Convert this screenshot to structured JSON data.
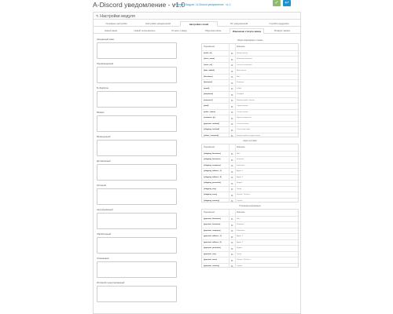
{
  "header": {
    "title": "A-Discord уведомление - v1.0",
    "breadcrumb": {
      "home": "Главная",
      "sep": "/",
      "modules": "Модули",
      "current": "A-Discord уведомление - v1.0"
    },
    "save_icon": "✓",
    "back_icon": "↩"
  },
  "panel": {
    "title": "Настройки модуля",
    "pencil_icon": "✎"
  },
  "tabs": [
    {
      "label": "Основные настройки",
      "active": false
    },
    {
      "label": "Настройка уведомлений",
      "active": false
    },
    {
      "label": "Настройка статей",
      "active": true
    },
    {
      "label": "Лог уведомлений",
      "active": false
    },
    {
      "label": "Служба поддержки",
      "active": false
    }
  ],
  "subtabs": [
    {
      "label": "Новый заказ",
      "active": false
    },
    {
      "label": "Новый пользователь",
      "active": false
    },
    {
      "label": "Отзыв к товару",
      "active": false
    },
    {
      "label": "Обратная связь",
      "active": false
    },
    {
      "label": "Изменение статуса заказа",
      "active": true
    },
    {
      "label": "Возврат заказа",
      "active": false
    }
  ],
  "fields": [
    {
      "label": "Ожидающий заказ"
    },
    {
      "label": "Подтвержденный"
    },
    {
      "label": "В обработке"
    },
    {
      "label": "Возврат"
    },
    {
      "label": "Возмещенный"
    },
    {
      "label": "Доставленный"
    },
    {
      "label": "Истекший"
    },
    {
      "label": "Аннулированный"
    },
    {
      "label": "Обработанный"
    },
    {
      "label": "Отменённый"
    },
    {
      "label": "Истёкший и аннулированный"
    }
  ],
  "variables": {
    "copy_icon": "⧉",
    "header_variable": "Переменная",
    "header_value": "Значение",
    "sections": [
      {
        "title": "Общая информация о заказе",
        "rows": [
          {
            "var": "{order_id}",
            "val": "Номер заказа"
          },
          {
            "var": "{store_name}",
            "val": "Название магазина"
          },
          {
            "var": "{store_url}",
            "val": "Ссылка на магазин"
          },
          {
            "var": "{date_added}",
            "val": "Дата заказа"
          },
          {
            "var": "{firstname}",
            "val": "Имя"
          },
          {
            "var": "{lastname}",
            "val": "Фамилия"
          },
          {
            "var": "{email}",
            "val": "E-Mail"
          },
          {
            "var": "{telephone}",
            "val": "Телефон"
          },
          {
            "var": "{comment}",
            "val": "Комментарий к заказу"
          },
          {
            "var": "{total}",
            "val": "Сумма заказа"
          },
          {
            "var": "{order_status}",
            "val": "Статус заказа"
          },
          {
            "var": "{customer_ip}",
            "val": "Группа покупателя"
          },
          {
            "var": "{payment_method}",
            "val": "Способ оплаты"
          },
          {
            "var": "{shipping_method}",
            "val": "Способ доставки"
          },
          {
            "var": "{status_comment}",
            "val": "Комментарий истории заказа"
          }
        ]
      },
      {
        "title": "Адрес доставки",
        "rows": [
          {
            "var": "{shipping_firstname}",
            "val": "Имя"
          },
          {
            "var": "{shipping_lastname}",
            "val": "Фамилия"
          },
          {
            "var": "{shipping_company}",
            "val": "Компания"
          },
          {
            "var": "{shipping_address_1}",
            "val": "Адрес 1"
          },
          {
            "var": "{shipping_address_2}",
            "val": "Адрес 2"
          },
          {
            "var": "{shipping_postcode}",
            "val": "Индекс"
          },
          {
            "var": "{shipping_city}",
            "val": "Город"
          },
          {
            "var": "{shipping_zone}",
            "val": "Регион / Область"
          },
          {
            "var": "{shipping_country}",
            "val": "Страна"
          }
        ]
      },
      {
        "title": "Платежная информация",
        "rows": [
          {
            "var": "{payment_firstname}",
            "val": "Имя"
          },
          {
            "var": "{payment_lastname}",
            "val": "Фамилия"
          },
          {
            "var": "{payment_company}",
            "val": "Компания"
          },
          {
            "var": "{payment_address_1}",
            "val": "Адрес 1"
          },
          {
            "var": "{payment_address_2}",
            "val": "Адрес 2"
          },
          {
            "var": "{payment_postcode}",
            "val": "Индекс"
          },
          {
            "var": "{payment_city}",
            "val": "Город"
          },
          {
            "var": "{payment_zone}",
            "val": "Регион / Область"
          },
          {
            "var": "{payment_country}",
            "val": "Страна"
          }
        ]
      }
    ]
  }
}
